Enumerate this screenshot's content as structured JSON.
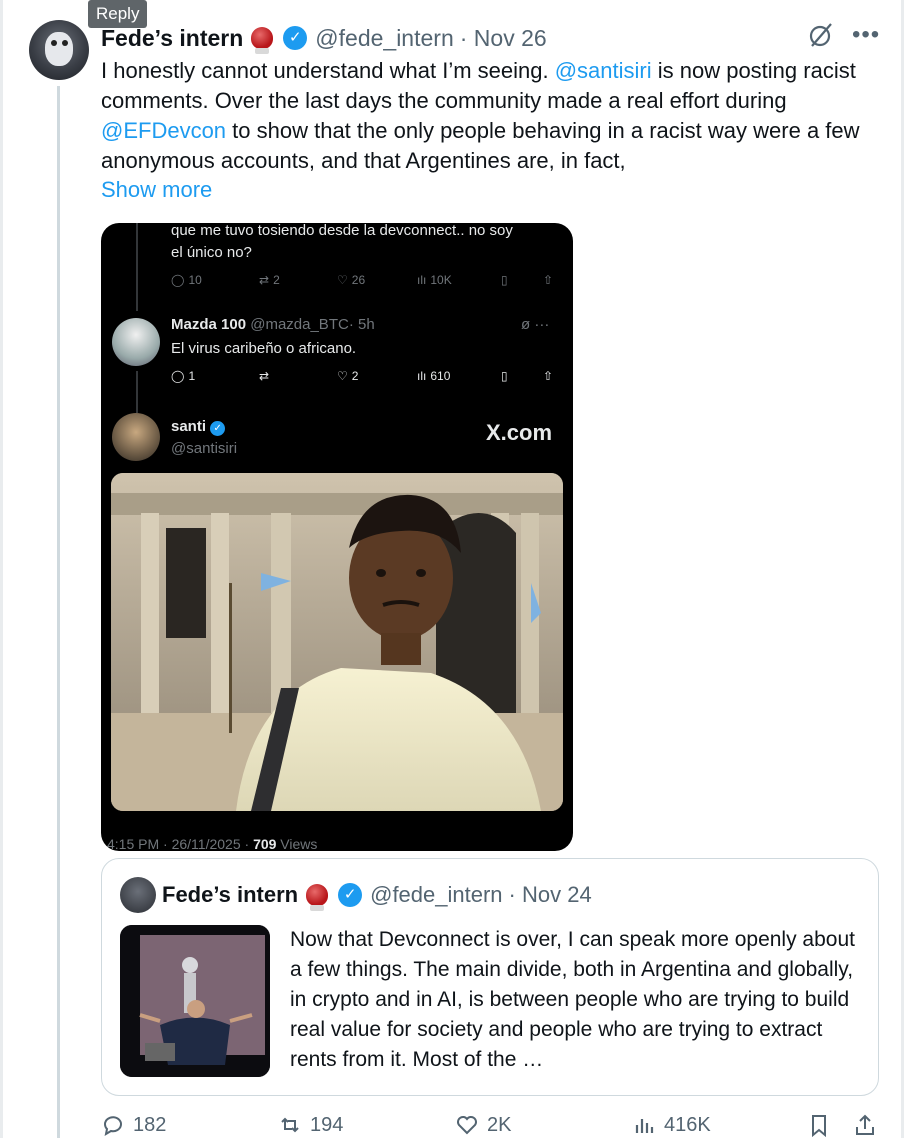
{
  "tooltip": "Reply",
  "author": {
    "name": "Fede’s intern",
    "handle": "@fede_intern",
    "date": "· Nov 26"
  },
  "tweet": {
    "text_1": "I honestly cannot understand what I’m seeing. ",
    "mention_1": "@santisiri",
    "text_2": " is now posting racist comments. Over the last days the community made a real effort during ",
    "mention_2": "@EFDevcon",
    "text_3": " to show that the only people behaving in a racist way were a few anonymous accounts, and that Argentines are, in fact,",
    "show_more": "Show more"
  },
  "screenshot": {
    "prev_text_1": "que me tuvo tosiendo desde la devconnect.. no soy",
    "prev_text_2": "el único no?",
    "prev_replies": "10",
    "prev_reposts": "2",
    "prev_likes": "26",
    "prev_views": "10K",
    "reply": {
      "name": "Mazda 100",
      "handle": "@mazda_BTC",
      "time": "· 5h",
      "text": "El virus caribeño o africano.",
      "replies": "1",
      "likes": "2",
      "views": "610"
    },
    "main": {
      "name": "santi",
      "handle": "@santisiri",
      "brand": "X.com",
      "meta_prefix": "4:15 PM · 26/11/2025 · ",
      "views_count": "709",
      "views_label": " Views"
    }
  },
  "quote": {
    "name": "Fede’s intern",
    "handle": "@fede_intern",
    "date": "· Nov 24",
    "text": "Now that Devconnect is over, I can speak more openly about a few things. The main divide, both in Argentina and globally, in crypto and in AI, is between people who are trying to build real value for society and people who are trying to extract rents from it. Most of the  …"
  },
  "stats": {
    "replies": "182",
    "reposts": "194",
    "likes": "2K",
    "views": "416K"
  },
  "colors": {
    "accent": "#1d9bf0",
    "muted": "#536471",
    "dark_bg": "#000000"
  },
  "icons": [
    "reply-icon",
    "repost-icon",
    "like-icon",
    "views-icon",
    "bookmark-icon",
    "share-icon",
    "grok-icon",
    "more-icon",
    "verified-icon",
    "boxing-glove-icon"
  ]
}
